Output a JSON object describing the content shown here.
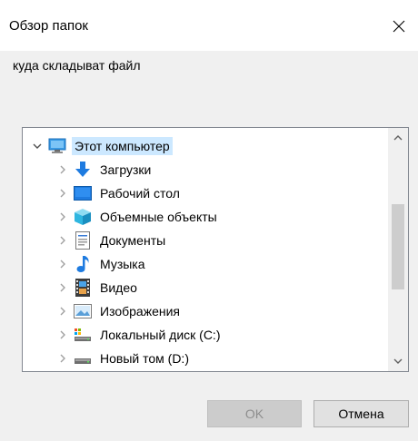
{
  "window": {
    "title": "Обзор папок",
    "prompt": "куда складыват файл"
  },
  "tree": {
    "items": [
      {
        "label": "Этот компьютер",
        "icon": "computer-icon",
        "expanded": true,
        "selected": true
      },
      {
        "label": "Загрузки",
        "icon": "downloads-icon"
      },
      {
        "label": "Рабочий стол",
        "icon": "desktop-icon"
      },
      {
        "label": "Объемные объекты",
        "icon": "3d-objects-icon"
      },
      {
        "label": "Документы",
        "icon": "documents-icon"
      },
      {
        "label": "Музыка",
        "icon": "music-icon"
      },
      {
        "label": "Видео",
        "icon": "video-icon"
      },
      {
        "label": "Изображения",
        "icon": "pictures-icon"
      },
      {
        "label": "Локальный диск (C:)",
        "icon": "local-disk-icon"
      },
      {
        "label": "Новый том (D:)",
        "icon": "drive-icon"
      }
    ]
  },
  "buttons": {
    "ok": "OK",
    "cancel": "Отмена"
  },
  "colors": {
    "selection": "#cce8ff",
    "accent_blue": "#1e7be0"
  }
}
